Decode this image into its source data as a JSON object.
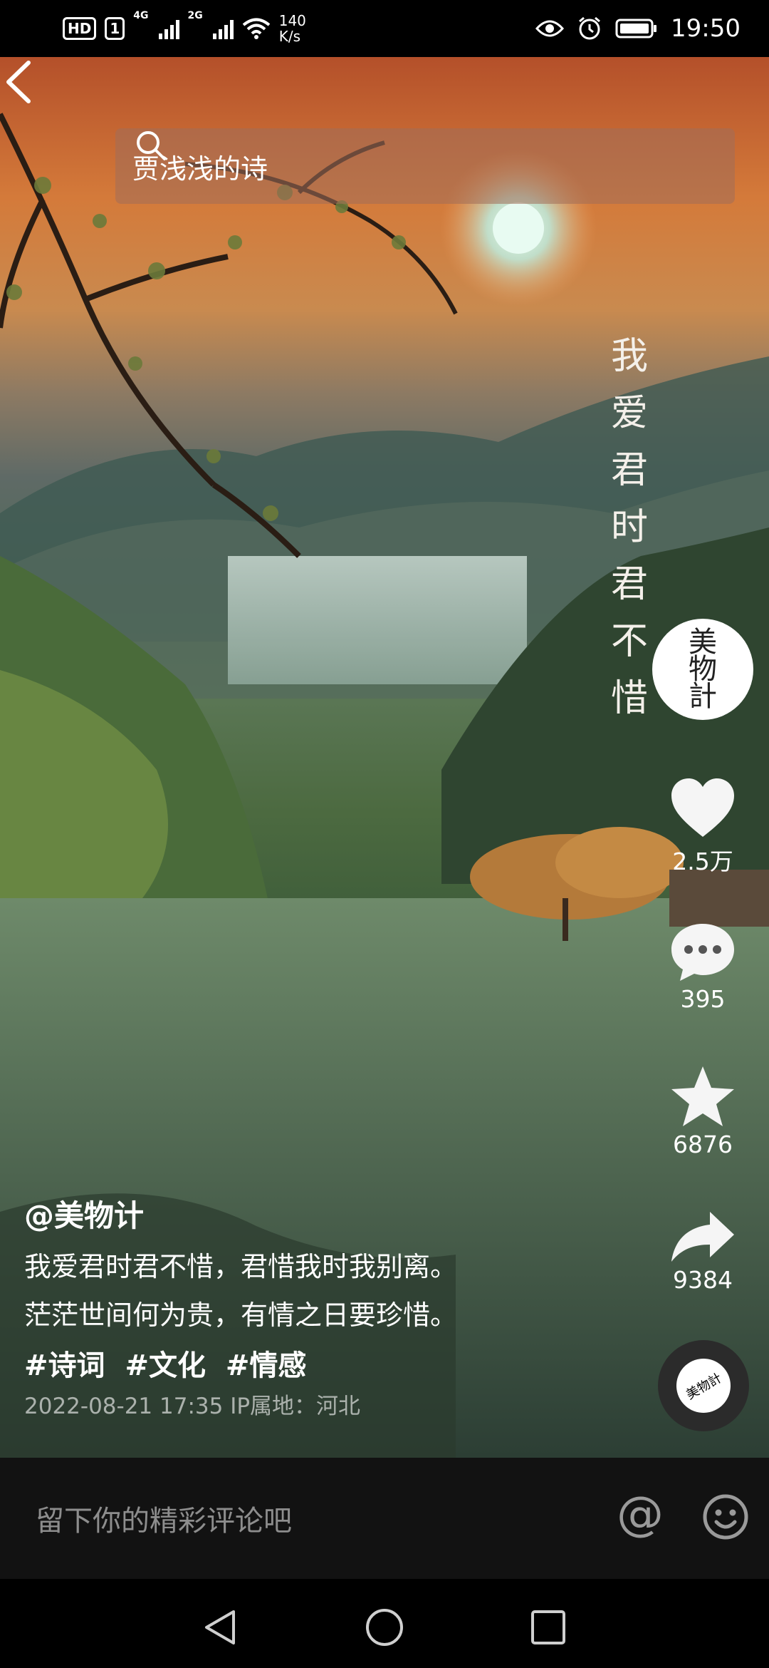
{
  "status_bar": {
    "hd": "HD",
    "sim1": "1",
    "net1": "4G",
    "net2": "2G",
    "speed_value": "140",
    "speed_unit": "K/s",
    "time": "19:50"
  },
  "search": {
    "query": "贾浅浅的诗"
  },
  "overlay_poem": [
    "我",
    "爱",
    "君",
    "时",
    "君",
    "不",
    "惜"
  ],
  "creator": {
    "avatar_text": [
      "美",
      "物",
      "計"
    ]
  },
  "actions": {
    "likes": "2.5万",
    "comments": "395",
    "favorites": "6876",
    "shares": "9384"
  },
  "music_disc_label": "美物計",
  "caption": {
    "author": "@美物计",
    "line1": "我爱君时君不惜，君惜我时我别离。",
    "line2": "茫茫世间何为贵，有情之日要珍惜。",
    "tags": [
      "#诗词",
      "#文化",
      "#情感"
    ],
    "meta": "2022-08-21 17:35  IP属地：河北"
  },
  "comment_bar": {
    "placeholder": "留下你的精彩评论吧",
    "at": "@"
  }
}
